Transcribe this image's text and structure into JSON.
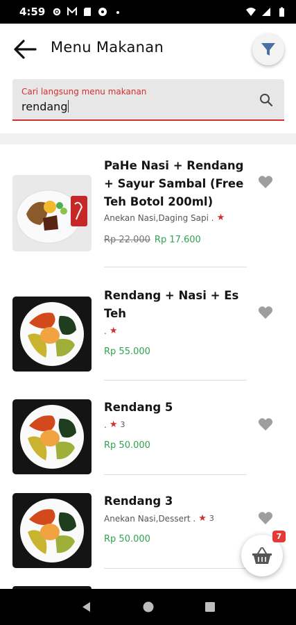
{
  "status_bar": {
    "time": "4:59"
  },
  "header": {
    "title": "Menu Makanan"
  },
  "search": {
    "label": "Cari langsung menu makanan",
    "value": "rendang"
  },
  "items": [
    {
      "name": "PaHe Nasi + Rendang + Sayur Sambal (Free Teh Botol 200ml)",
      "meta": "Anekan Nasi,Daging Sapi .",
      "rating": "",
      "price_old": "Rp 22.000",
      "price": "Rp 17.600"
    },
    {
      "name": "Rendang + Nasi + Es Teh",
      "meta": ".",
      "rating": "",
      "price_old": "",
      "price": "Rp 55.000"
    },
    {
      "name": "Rendang 5",
      "meta": ".",
      "rating": "3",
      "price_old": "",
      "price": "Rp 50.000"
    },
    {
      "name": "Rendang 3",
      "meta": "Anekan Nasi,Dessert .",
      "rating": "3",
      "price_old": "",
      "price": "Rp 50.000"
    }
  ],
  "cart": {
    "count": "7"
  },
  "colors": {
    "accent": "#d32f2f",
    "price": "#2ea44f",
    "badge": "#e53935"
  },
  "icons": [
    "back-arrow-icon",
    "filter-icon",
    "search-icon",
    "star-icon",
    "heart-icon",
    "basket-icon"
  ]
}
